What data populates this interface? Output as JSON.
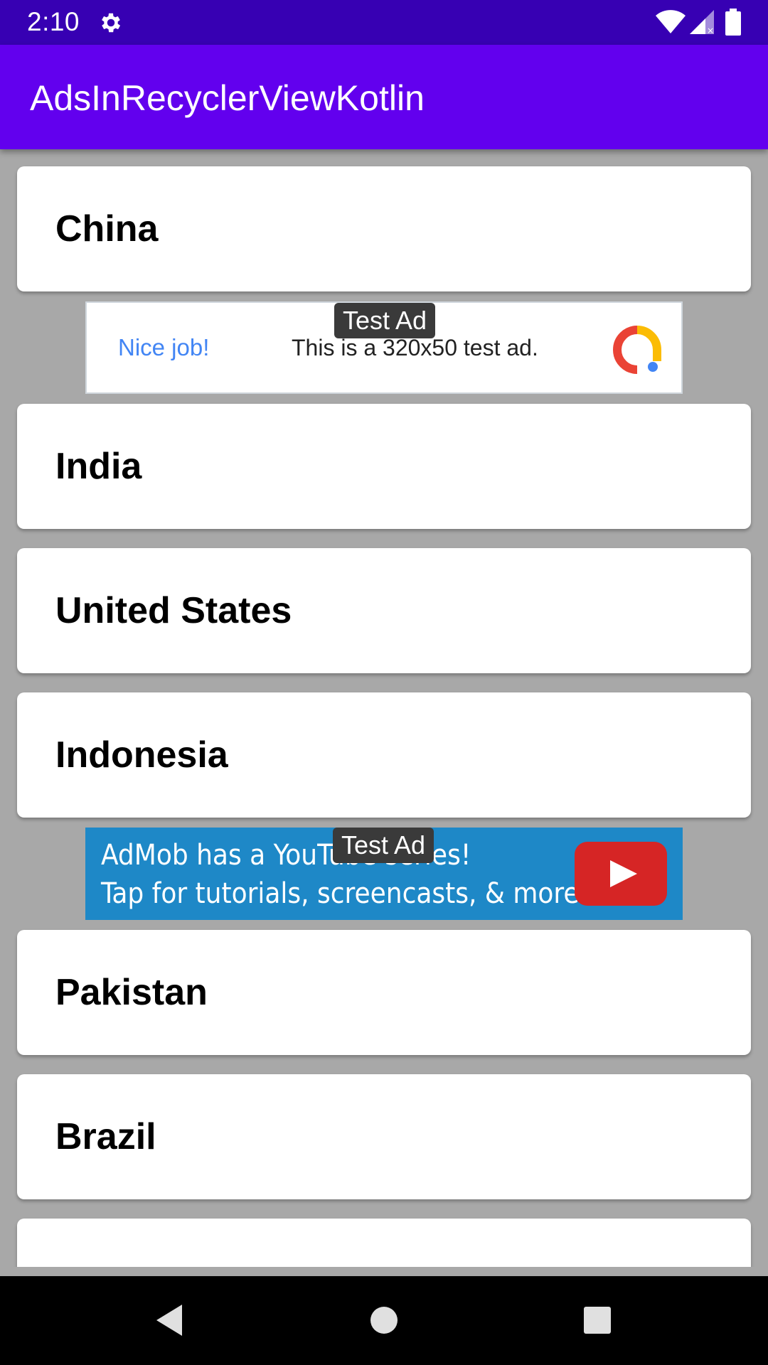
{
  "status_bar": {
    "time": "2:10",
    "icons": [
      "gear-icon",
      "wifi-icon",
      "cell-signal-icon",
      "battery-icon"
    ]
  },
  "app_bar": {
    "title": "AdsInRecyclerViewKotlin",
    "color": "#6200ee",
    "status_color": "#3700b3"
  },
  "list": {
    "items": [
      {
        "label": "China"
      },
      {
        "label": "India"
      },
      {
        "label": "United States"
      },
      {
        "label": "Indonesia"
      },
      {
        "label": "Pakistan"
      },
      {
        "label": "Brazil"
      },
      {
        "label": ""
      }
    ]
  },
  "ads": [
    {
      "badge": "Test Ad",
      "headline": "Nice job!",
      "text": "This is a 320x50 test ad.",
      "logo": "admob-logo-icon"
    },
    {
      "badge": "Test Ad",
      "line1": "AdMob has a YouTube series!",
      "line2": "Tap for tutorials, screencasts, & more.",
      "logo": "youtube-play-icon",
      "color": "#1e88c7"
    }
  ],
  "nav_bar": {
    "buttons": [
      "back-icon",
      "home-icon",
      "recents-icon"
    ]
  }
}
